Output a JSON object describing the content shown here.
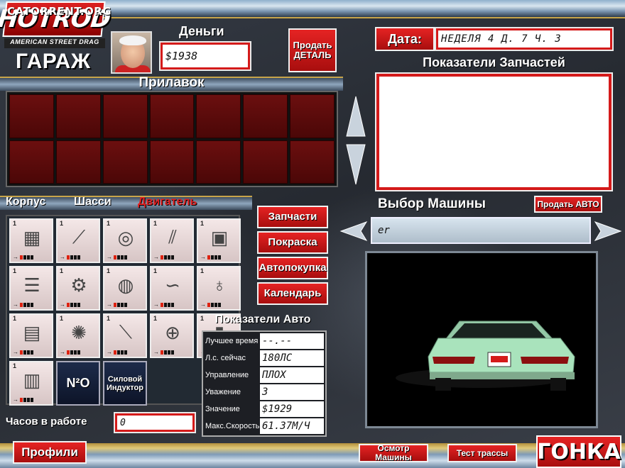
{
  "watermark": "CATORRENT.ORG",
  "logo": {
    "main": "HOTROD",
    "sub": "AMERICAN STREET DRAG"
  },
  "screen_title": "ГАРАЖ",
  "money": {
    "label": "Деньги",
    "value": "$1938"
  },
  "sell_part_label": "Продать ДЕТАЛЬ",
  "date": {
    "label": "Дата:",
    "value": "НЕДЕЛЯ 4 Д. 7 Ч. 3"
  },
  "parts_stats_title": "Показатели Запчастей",
  "counter": {
    "title": "Прилавок",
    "slot_count": 14
  },
  "tabs": [
    {
      "label": "Корпус",
      "active": false
    },
    {
      "label": "Шасси",
      "active": false
    },
    {
      "label": "Двигатель",
      "active": true
    }
  ],
  "parts": [
    {
      "icon": "engine-block-icon",
      "count": "1",
      "level": 1
    },
    {
      "icon": "crankshaft-icon",
      "count": "1",
      "level": 1
    },
    {
      "icon": "pistons-icon",
      "count": "1",
      "level": 1
    },
    {
      "icon": "valves-icon",
      "count": "1",
      "level": 1
    },
    {
      "icon": "oil-pump-icon",
      "count": "1",
      "level": 1
    },
    {
      "icon": "intake-manifold-icon",
      "count": "1",
      "level": 1
    },
    {
      "icon": "exhaust-manifold-icon",
      "count": "1",
      "level": 1
    },
    {
      "icon": "air-filter-icon",
      "count": "1",
      "level": 1
    },
    {
      "icon": "ignition-wires-icon",
      "count": "1",
      "level": 1
    },
    {
      "icon": "distributor-icon",
      "count": "1",
      "level": 1
    },
    {
      "icon": "radiator-icon",
      "count": "1",
      "level": 1
    },
    {
      "icon": "flywheel-icon",
      "count": "1",
      "level": 1
    },
    {
      "icon": "camshaft-icon",
      "count": "1",
      "level": 1
    },
    {
      "icon": "fuel-pump-icon",
      "count": "1",
      "level": 1
    },
    {
      "icon": "fuel-filter-icon",
      "count": "1",
      "level": 1
    },
    {
      "icon": "oil-can-icon",
      "count": "1",
      "level": 1
    }
  ],
  "special_tiles": [
    "N²O",
    "Силовой Индуктор"
  ],
  "menu_buttons": [
    "Запчасти",
    "Покраска",
    "Автопокупка",
    "Календарь"
  ],
  "car_stats": {
    "title": "Показатели Авто",
    "rows": [
      {
        "label": "Лучшее время",
        "value": "--.--"
      },
      {
        "label": "Л.с. сейчас",
        "value": "180ЛС"
      },
      {
        "label": "Управление",
        "value": "ПЛОХ"
      },
      {
        "label": "Уважение",
        "value": "3"
      },
      {
        "label": "Значение",
        "value": "$1929"
      },
      {
        "label": "Макс.Скорость",
        "value": "61.37М/Ч"
      }
    ]
  },
  "hours": {
    "label": "Часов в работе",
    "value": "0"
  },
  "car_select": {
    "title": "Выбор Машины",
    "value": "er",
    "sell_label": "Продать АВТО"
  },
  "bottom": {
    "profiles": "Профили",
    "inspect": "Осмотр Машины",
    "test_track": "Тест трассы",
    "race": "ГОНКА"
  },
  "colors": {
    "accent_red": "#d41a1a",
    "slot_red": "#5b0a0a",
    "car_body": "#a9e3bc"
  }
}
